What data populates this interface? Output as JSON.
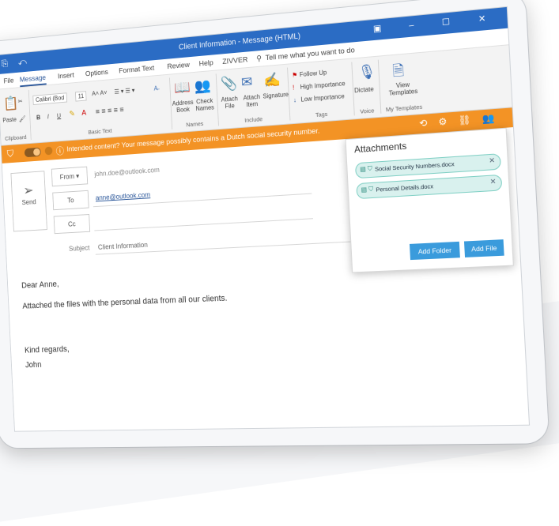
{
  "window": {
    "title": "Client Information - Message (HTML)",
    "quick_access": "⎘ ↶",
    "controls": "▣ – ☐ ✕"
  },
  "tabs": [
    "File",
    "Message",
    "Insert",
    "Options",
    "Format Text",
    "Review",
    "Help",
    "ZIVVER"
  ],
  "tell_me": "Tell me what you want to do",
  "ribbon": {
    "paste": "Paste",
    "clipboard": "Clipboard",
    "font": "Calibri (Bod",
    "font_size": "11",
    "basic_text": "Basic Text",
    "address_book": "Address Book",
    "check_names": "Check Names",
    "names": "Names",
    "attach_file": "Attach File",
    "attach_item": "Attach Item",
    "signature": "Signature",
    "include": "Include",
    "follow_up": "Follow Up",
    "high_importance": "High Importance",
    "low_importance": "Low Importance",
    "tags": "Tags",
    "dictate": "Dictate",
    "voice": "Voice",
    "view_templates": "View Templates",
    "my_templates": "My Templates"
  },
  "warning": {
    "text": "Intended content? Your message possibly contains a Dutch social security number.",
    "color": "#f39325"
  },
  "compose": {
    "send": "Send",
    "from_label": "From",
    "from_value": "john.doe@outlook.com",
    "to_label": "To",
    "to_value": "anne@outlook.com",
    "cc_label": "Cc",
    "subject_label": "Subject",
    "subject_value": "Client Information"
  },
  "body": {
    "greeting": "Dear Anne,",
    "line1": "Attached the files with the personal data from all our clients.",
    "closing": "Kind regards,",
    "signature": "John"
  },
  "attachments": {
    "title": "Attachments",
    "files": [
      "Social Security Numbers.docx",
      "Personal Details.docx"
    ],
    "add_folder": "Add Folder",
    "add_file": "Add File"
  }
}
